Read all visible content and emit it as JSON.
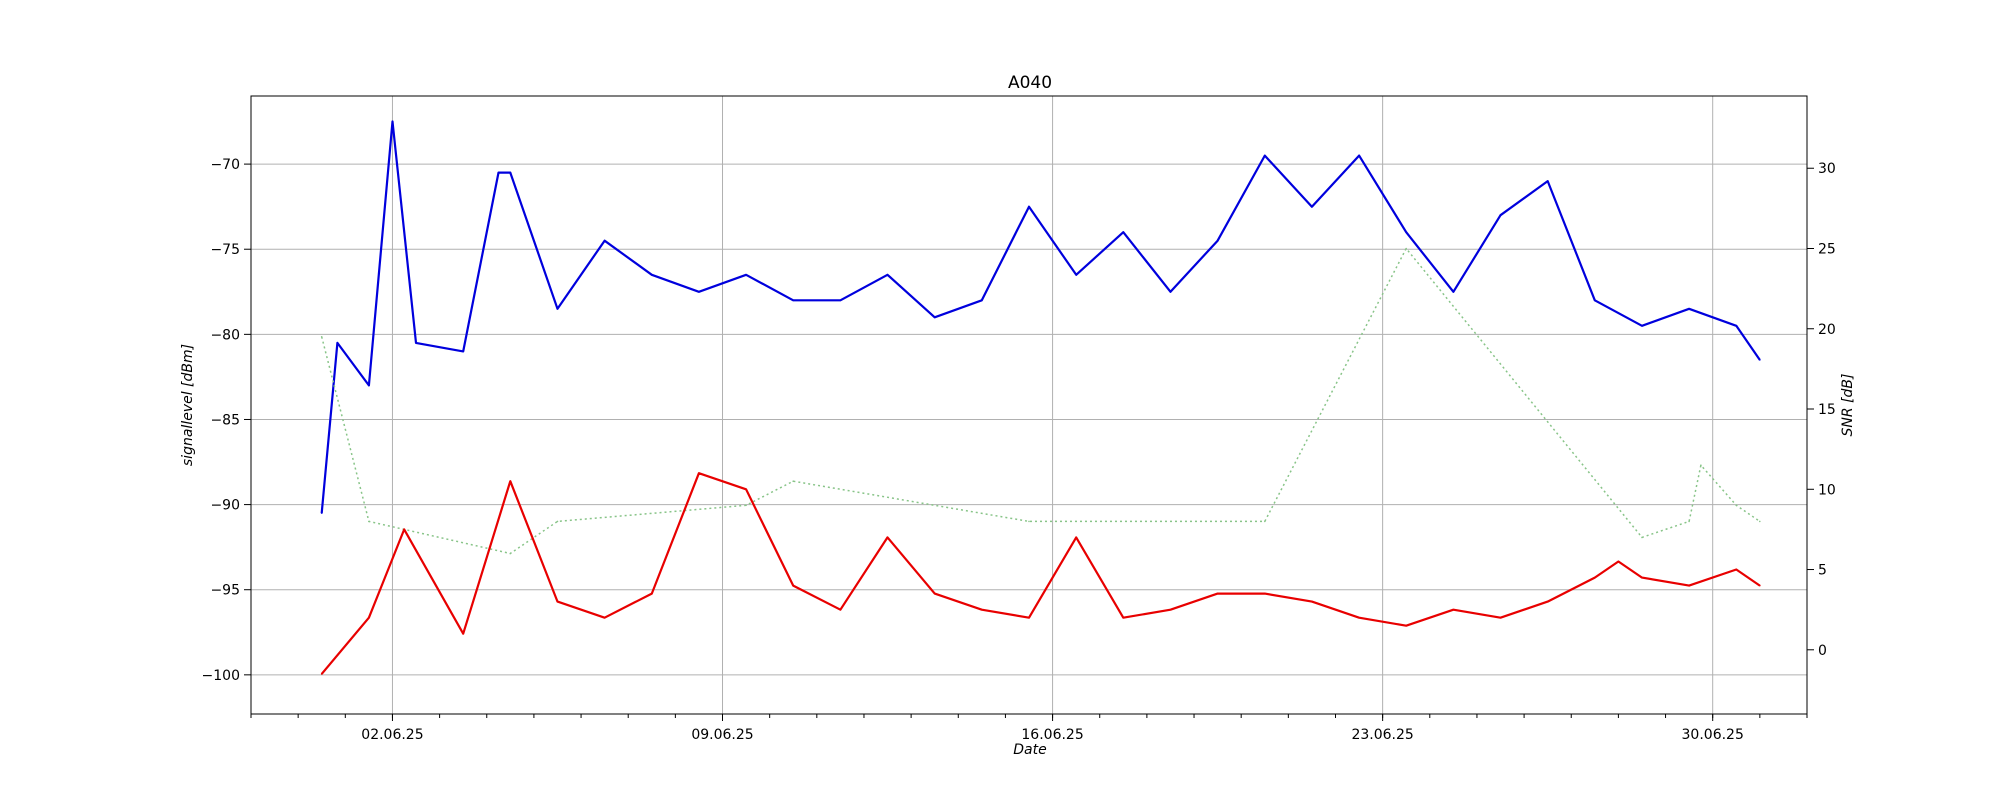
{
  "chart_data": {
    "type": "line",
    "title": "A040",
    "xlabel": "Date",
    "ylabel_left": "signallevel [dBm]",
    "ylabel_right": "SNR [dB]",
    "x_tick_labels": [
      "02.06.25",
      "09.06.25",
      "16.06.25",
      "23.06.25",
      "30.06.25"
    ],
    "x_tick_dates": [
      "2025-06-02",
      "2025-06-09",
      "2025-06-16",
      "2025-06-23",
      "2025-06-30"
    ],
    "xlim": [
      "2025-05-30",
      "2025-07-02"
    ],
    "ylim_left": [
      -102.3,
      -66.0
    ],
    "ylim_right": [
      -4.0,
      34.5
    ],
    "left_ticks": [
      -100,
      -95,
      -90,
      -85,
      -80,
      -75,
      -70
    ],
    "right_ticks": [
      0,
      5,
      10,
      15,
      20,
      25,
      30
    ],
    "grid": true,
    "series": [
      {
        "axis": "left",
        "color": "#0000dd",
        "style": "solid",
        "x": [
          "2025-05-31 12:00",
          "2025-05-31 20:00",
          "2025-06-01 12:00",
          "2025-06-02 00:00",
          "2025-06-02 12:00",
          "2025-06-03 12:00",
          "2025-06-04 06:00",
          "2025-06-04 12:00",
          "2025-06-05 12:00",
          "2025-06-06 12:00",
          "2025-06-07 12:00",
          "2025-06-08 12:00",
          "2025-06-09 12:00",
          "2025-06-10 12:00",
          "2025-06-11 12:00",
          "2025-06-12 12:00",
          "2025-06-13 12:00",
          "2025-06-14 12:00",
          "2025-06-15 12:00",
          "2025-06-16 12:00",
          "2025-06-17 12:00",
          "2025-06-18 12:00",
          "2025-06-19 12:00",
          "2025-06-20 12:00",
          "2025-06-21 12:00",
          "2025-06-22 12:00",
          "2025-06-23 12:00",
          "2025-06-24 12:00",
          "2025-06-25 12:00",
          "2025-06-26 12:00",
          "2025-06-27 12:00",
          "2025-06-28 12:00",
          "2025-06-29 12:00",
          "2025-06-30 12:00",
          "2025-07-01 00:00"
        ],
        "y": [
          -90.5,
          -80.5,
          -83.0,
          -67.5,
          -80.5,
          -81.0,
          -70.5,
          -70.5,
          -78.5,
          -74.5,
          -76.5,
          -77.5,
          -76.5,
          -78.0,
          -78.0,
          -76.5,
          -79.0,
          -78.0,
          -72.5,
          -76.5,
          -74.0,
          -77.5,
          -74.5,
          -69.5,
          -72.5,
          -69.5,
          -74.0,
          -77.5,
          -73.0,
          -71.0,
          -78.0,
          -79.5,
          -78.5,
          -79.5,
          -81.5
        ]
      },
      {
        "axis": "right",
        "color": "#88c488",
        "style": "dotted",
        "x": [
          "2025-05-31 12:00",
          "2025-06-01 12:00",
          "2025-06-04 12:00",
          "2025-06-05 12:00",
          "2025-06-09 12:00",
          "2025-06-10 12:00",
          "2025-06-15 12:00",
          "2025-06-20 12:00",
          "2025-06-23 12:00",
          "2025-06-28 12:00",
          "2025-06-29 12:00",
          "2025-06-29 18:00",
          "2025-06-30 12:00",
          "2025-07-01 00:00"
        ],
        "y": [
          19.5,
          8.0,
          6.0,
          8.0,
          9.0,
          10.5,
          8.0,
          8.0,
          25.0,
          7.0,
          8.0,
          11.5,
          9.0,
          8.0
        ]
      },
      {
        "axis": "right",
        "color": "#e80000",
        "style": "solid",
        "x": [
          "2025-05-31 12:00",
          "2025-06-01 12:00",
          "2025-06-02 06:00",
          "2025-06-03 12:00",
          "2025-06-04 12:00",
          "2025-06-05 12:00",
          "2025-06-06 12:00",
          "2025-06-07 12:00",
          "2025-06-08 12:00",
          "2025-06-09 12:00",
          "2025-06-10 12:00",
          "2025-06-11 12:00",
          "2025-06-12 12:00",
          "2025-06-13 12:00",
          "2025-06-14 12:00",
          "2025-06-15 12:00",
          "2025-06-16 12:00",
          "2025-06-17 12:00",
          "2025-06-18 12:00",
          "2025-06-19 12:00",
          "2025-06-20 12:00",
          "2025-06-21 12:00",
          "2025-06-22 12:00",
          "2025-06-23 12:00",
          "2025-06-24 12:00",
          "2025-06-25 12:00",
          "2025-06-26 12:00",
          "2025-06-27 12:00",
          "2025-06-28 00:00",
          "2025-06-28 12:00",
          "2025-06-29 12:00",
          "2025-06-30 12:00",
          "2025-07-01 00:00"
        ],
        "y": [
          -1.5,
          2.0,
          7.5,
          1.0,
          10.5,
          3.0,
          2.0,
          3.5,
          11.0,
          10.0,
          4.0,
          2.5,
          7.0,
          3.5,
          2.5,
          2.0,
          7.0,
          2.0,
          2.5,
          3.5,
          3.5,
          3.0,
          2.0,
          1.5,
          2.5,
          2.0,
          3.0,
          4.5,
          5.5,
          4.5,
          4.0,
          5.0,
          4.0
        ]
      }
    ]
  }
}
